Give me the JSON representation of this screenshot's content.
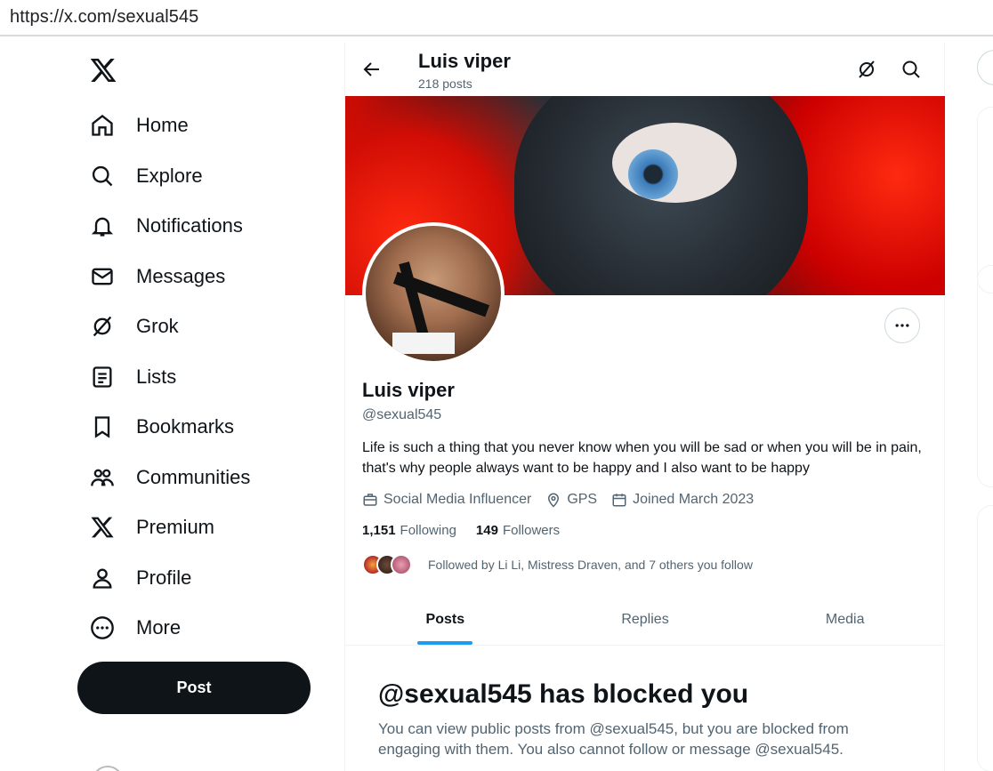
{
  "browser": {
    "url": "https://x.com/sexual545"
  },
  "nav": {
    "items": [
      {
        "label": "Home",
        "icon": "home-icon"
      },
      {
        "label": "Explore",
        "icon": "search-icon"
      },
      {
        "label": "Notifications",
        "icon": "bell-icon"
      },
      {
        "label": "Messages",
        "icon": "envelope-icon"
      },
      {
        "label": "Grok",
        "icon": "grok-icon"
      },
      {
        "label": "Lists",
        "icon": "list-icon"
      },
      {
        "label": "Bookmarks",
        "icon": "bookmark-icon"
      },
      {
        "label": "Communities",
        "icon": "people-icon"
      },
      {
        "label": "Premium",
        "icon": "x-logo-icon"
      },
      {
        "label": "Profile",
        "icon": "person-icon"
      },
      {
        "label": "More",
        "icon": "more-circle-icon"
      }
    ],
    "post_label": "Post"
  },
  "header": {
    "title": "Luis viper",
    "subtitle": "218 posts"
  },
  "profile": {
    "name": "Luis viper",
    "handle": "@sexual545",
    "bio": "Life is such a thing that you never know when you will be sad or when you will be in pain, that's why people always want to be happy and I also want to be happy",
    "category": "Social Media Influencer",
    "location": "GPS",
    "joined": "Joined March 2023",
    "following_count": "1,151",
    "following_label": "Following",
    "followers_count": "149",
    "followers_label": "Followers",
    "followed_by": "Followed by Li Li, Mistress Draven, and 7 others you follow"
  },
  "tabs": [
    {
      "label": "Posts",
      "active": true
    },
    {
      "label": "Replies",
      "active": false
    },
    {
      "label": "Media",
      "active": false
    }
  ],
  "blocked": {
    "title": "@sexual545 has blocked you",
    "text": "You can view public posts from @sexual545, but you are blocked from engaging with them. You also cannot follow or message @sexual545."
  },
  "colors": {
    "accent": "#1d9bf0",
    "text": "#0f1419",
    "secondary": "#536471",
    "post_button": "#0f1419"
  }
}
